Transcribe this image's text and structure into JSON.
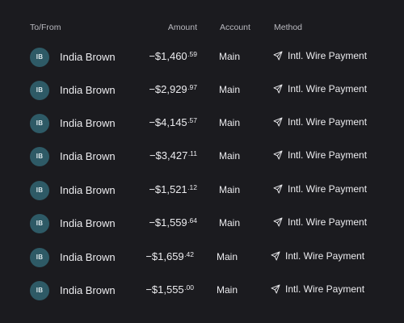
{
  "header": {
    "to_from": "To/From",
    "amount": "Amount",
    "account": "Account",
    "method": "Method"
  },
  "rows": [
    {
      "initials": "IB",
      "name": "India Brown",
      "amount_main": "−$1,460",
      "amount_cents": ".59",
      "account": "Main",
      "method": "Intl. Wire Payment",
      "method_icon": "send-icon"
    },
    {
      "initials": "IB",
      "name": "India Brown",
      "amount_main": "−$2,929",
      "amount_cents": ".97",
      "account": "Main",
      "method": "Intl. Wire Payment",
      "method_icon": "send-icon"
    },
    {
      "initials": "IB",
      "name": "India Brown",
      "amount_main": "−$4,145",
      "amount_cents": ".57",
      "account": "Main",
      "method": "Intl. Wire Payment",
      "method_icon": "send-icon"
    },
    {
      "initials": "IB",
      "name": "India Brown",
      "amount_main": "−$3,427",
      "amount_cents": ".11",
      "account": "Main",
      "method": "Intl. Wire Payment",
      "method_icon": "send-icon"
    },
    {
      "initials": "IB",
      "name": "India Brown",
      "amount_main": "−$1,521",
      "amount_cents": ".12",
      "account": "Main",
      "method": "Intl. Wire Payment",
      "method_icon": "send-icon"
    },
    {
      "initials": "IB",
      "name": "India Brown",
      "amount_main": "−$1,559",
      "amount_cents": ".64",
      "account": "Main",
      "method": "Intl. Wire Payment",
      "method_icon": "send-icon"
    },
    {
      "initials": "IB",
      "name": "India Brown",
      "amount_main": "−$1,659",
      "amount_cents": ".42",
      "account": "Main",
      "method": "Intl. Wire Payment",
      "method_icon": "send-icon"
    },
    {
      "initials": "IB",
      "name": "India Brown",
      "amount_main": "−$1,555",
      "amount_cents": ".00",
      "account": "Main",
      "method": "Intl. Wire Payment",
      "method_icon": "send-icon"
    }
  ],
  "colors": {
    "background": "#1b1b1f",
    "avatar": "#2e5a66",
    "text": "#ececef",
    "header_text": "#b9b9bf"
  }
}
